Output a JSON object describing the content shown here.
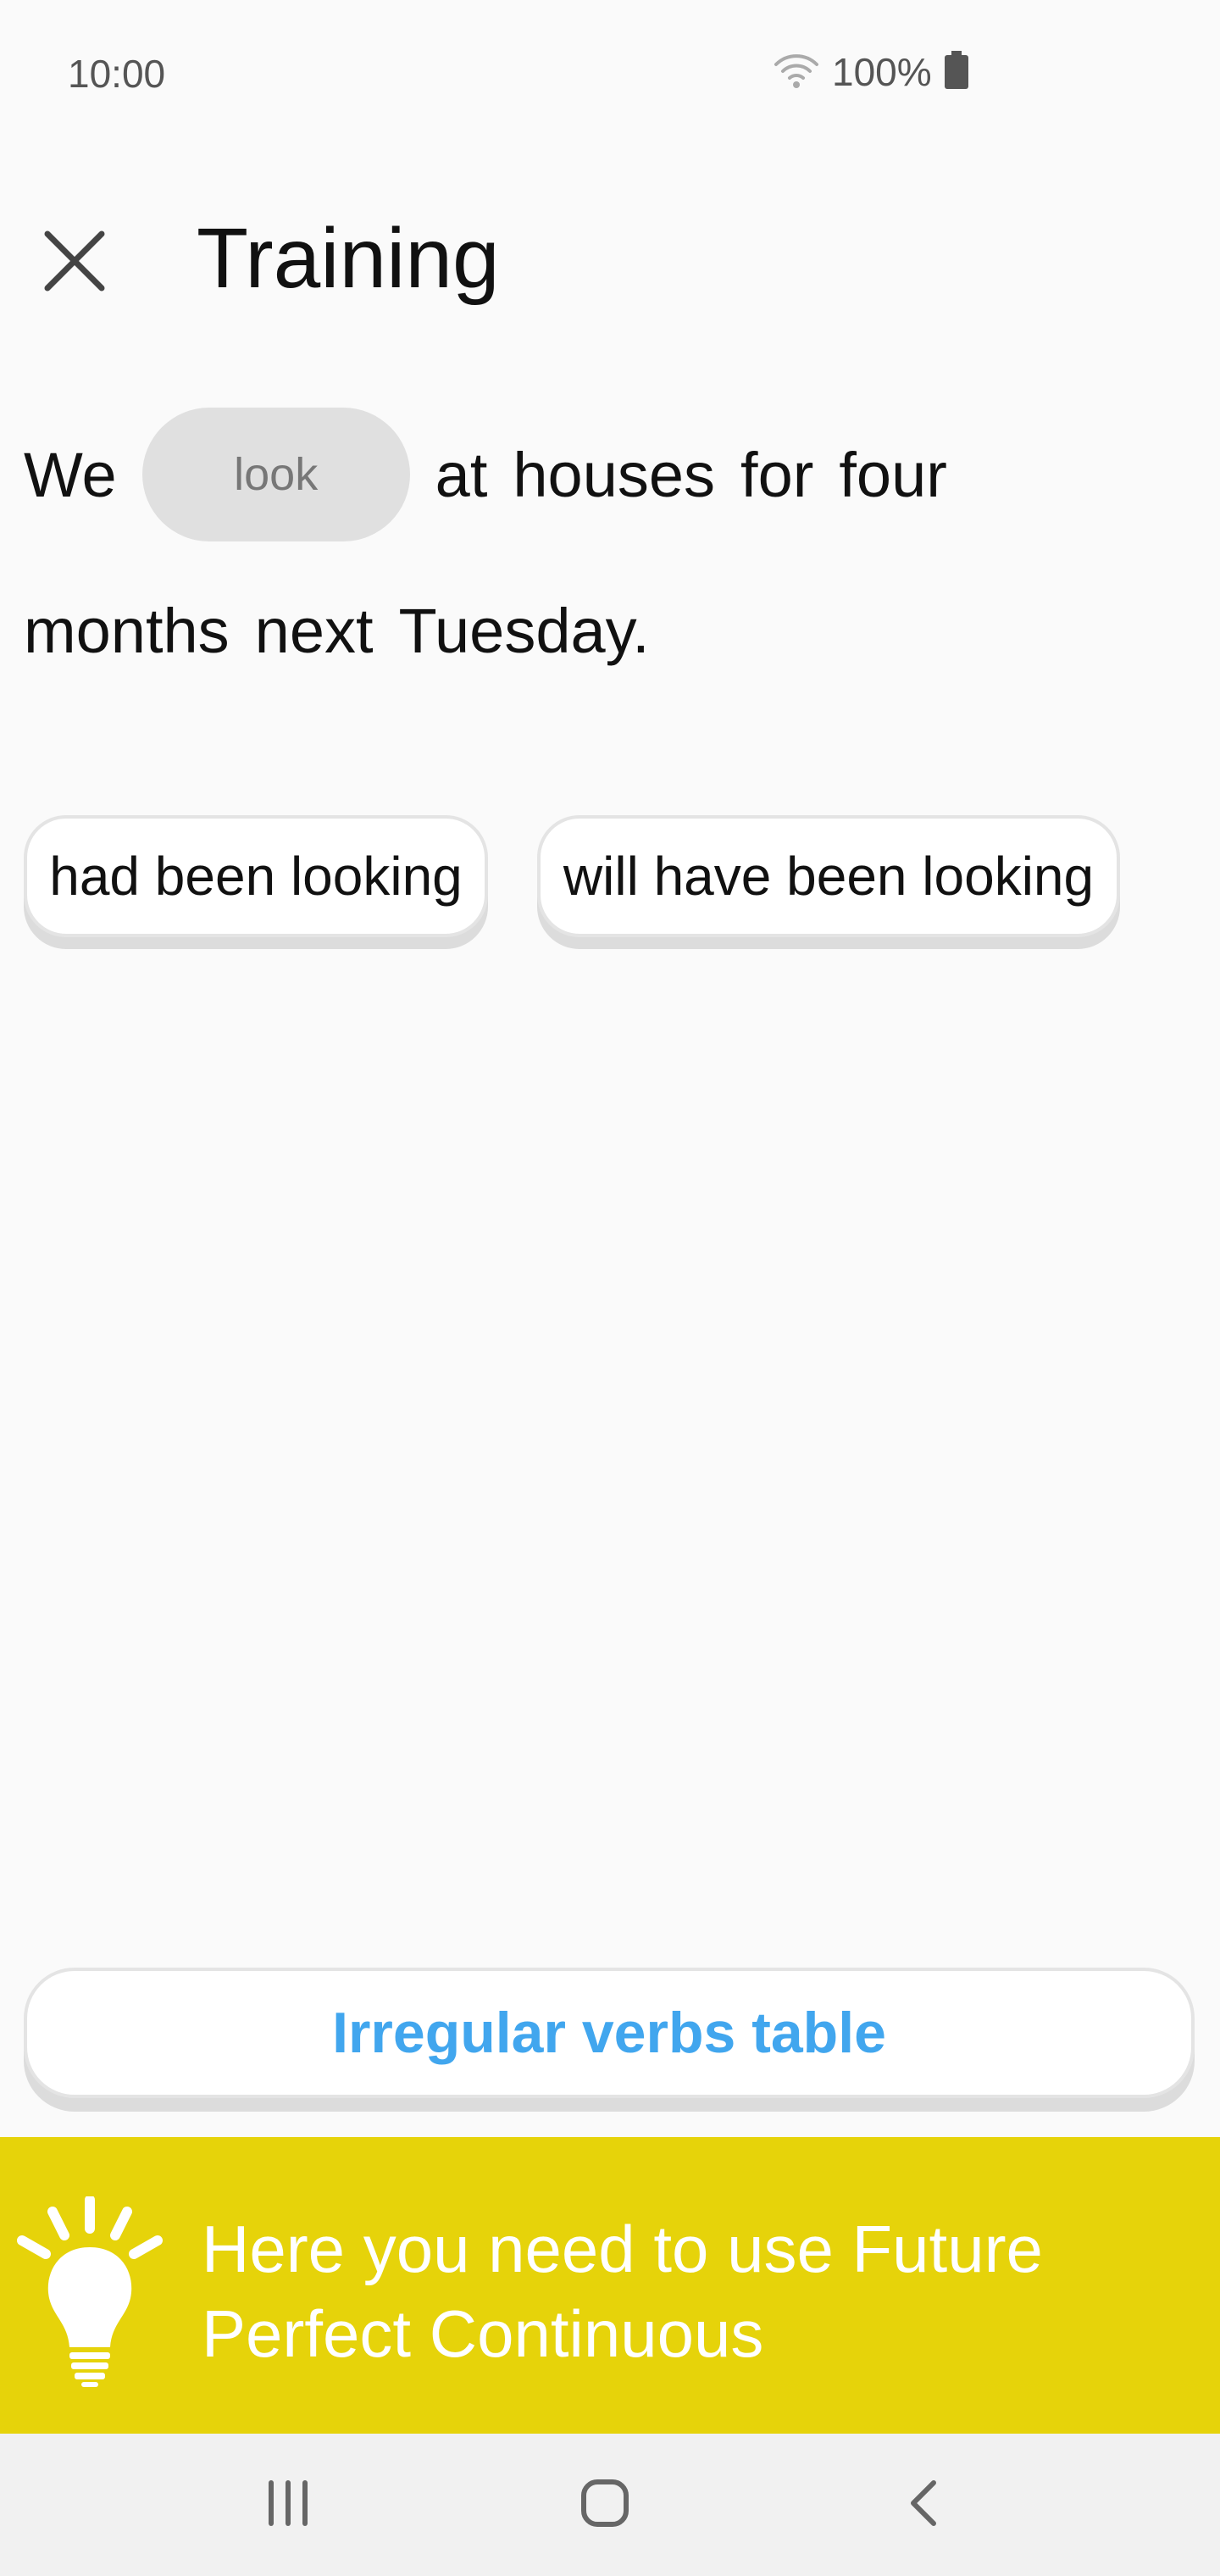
{
  "status_bar": {
    "time": "10:00",
    "battery": "100%",
    "icons": [
      "wifi-icon",
      "battery-icon"
    ]
  },
  "header": {
    "title": "Training",
    "close_icon": "close-icon"
  },
  "exercise": {
    "line1": {
      "word_before": "We",
      "blank_hint": "look",
      "words_after": [
        "at",
        "houses",
        "for",
        "four"
      ]
    },
    "line2": {
      "words": [
        "months",
        "next",
        "Tuesday."
      ]
    }
  },
  "options": [
    {
      "label": "had been looking"
    },
    {
      "label": "will have been looking"
    }
  ],
  "irregular_verbs": {
    "label": "Irregular verbs table"
  },
  "hint": {
    "icon": "lightbulb-icon",
    "text_line1": "Here you need to use Future",
    "text_line2": "Perfect Continuous"
  },
  "nav_bar": {
    "icons": [
      "recent-apps-icon",
      "home-icon",
      "back-icon"
    ]
  },
  "colors": {
    "background": "#fafafa",
    "accent_blue": "#41a6ee",
    "hint_yellow": "#e6d30a",
    "chip_gray": "#e0e0e0"
  }
}
